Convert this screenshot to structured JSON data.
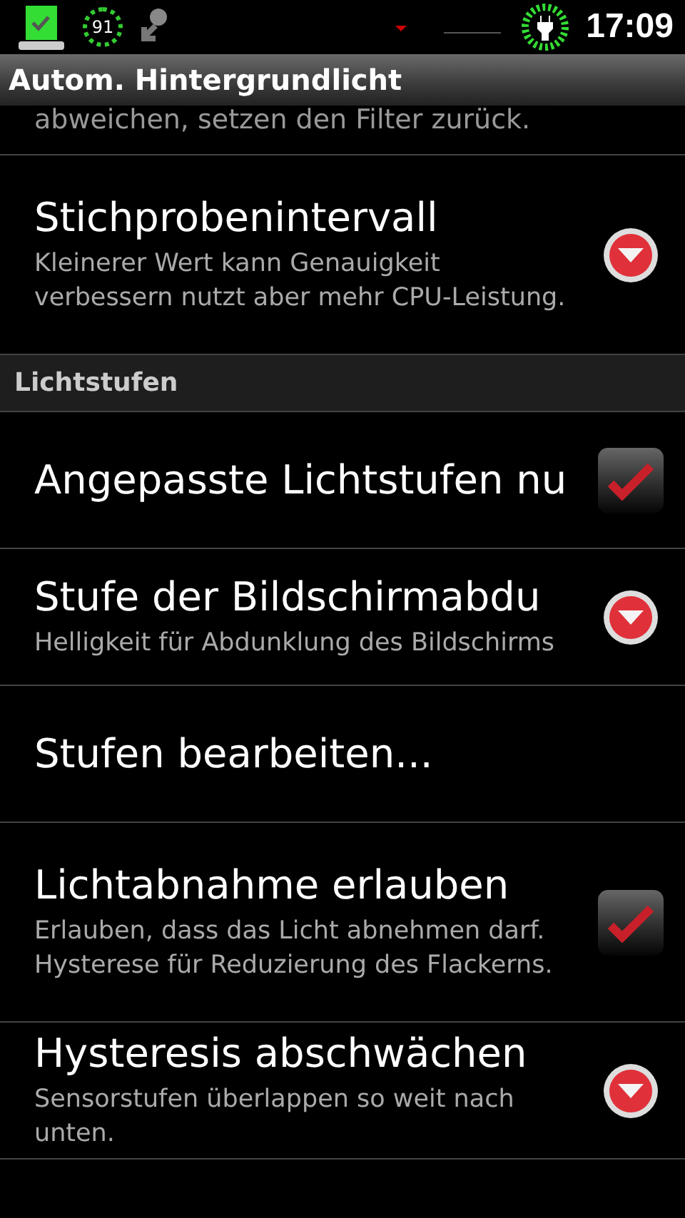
{
  "status_bar": {
    "gauge": "91",
    "time": "17:09"
  },
  "title_bar": {
    "title": "Autom. Hintergrundlicht"
  },
  "partial_summary": "abweichen, setzen den Filter zurück.",
  "sections": [
    {
      "items": [
        {
          "kind": "dropdown",
          "title": "Stichprobenintervall",
          "summary": "Kleinerer Wert kann Genauigkeit verbessern nutzt aber mehr CPU-Leistung."
        }
      ]
    },
    {
      "header": "Lichtstufen",
      "items": [
        {
          "kind": "checkbox",
          "title": "Angepasste Lichtstufen nu",
          "checked": true
        },
        {
          "kind": "dropdown",
          "title": "Stufe der Bildschirmabdu",
          "summary": "Helligkeit für Abdunklung des Bildschirms"
        },
        {
          "kind": "plain",
          "title": "Stufen bearbeiten..."
        },
        {
          "kind": "checkbox",
          "title": "Lichtabnahme erlauben",
          "summary": "Erlauben, dass das Licht abnehmen darf. Hysterese für Reduzierung des Flackerns.",
          "checked": true
        },
        {
          "kind": "dropdown",
          "title": "Hysteresis abschwächen",
          "summary": "Sensorstufen überlappen so weit nach unten."
        }
      ]
    }
  ]
}
